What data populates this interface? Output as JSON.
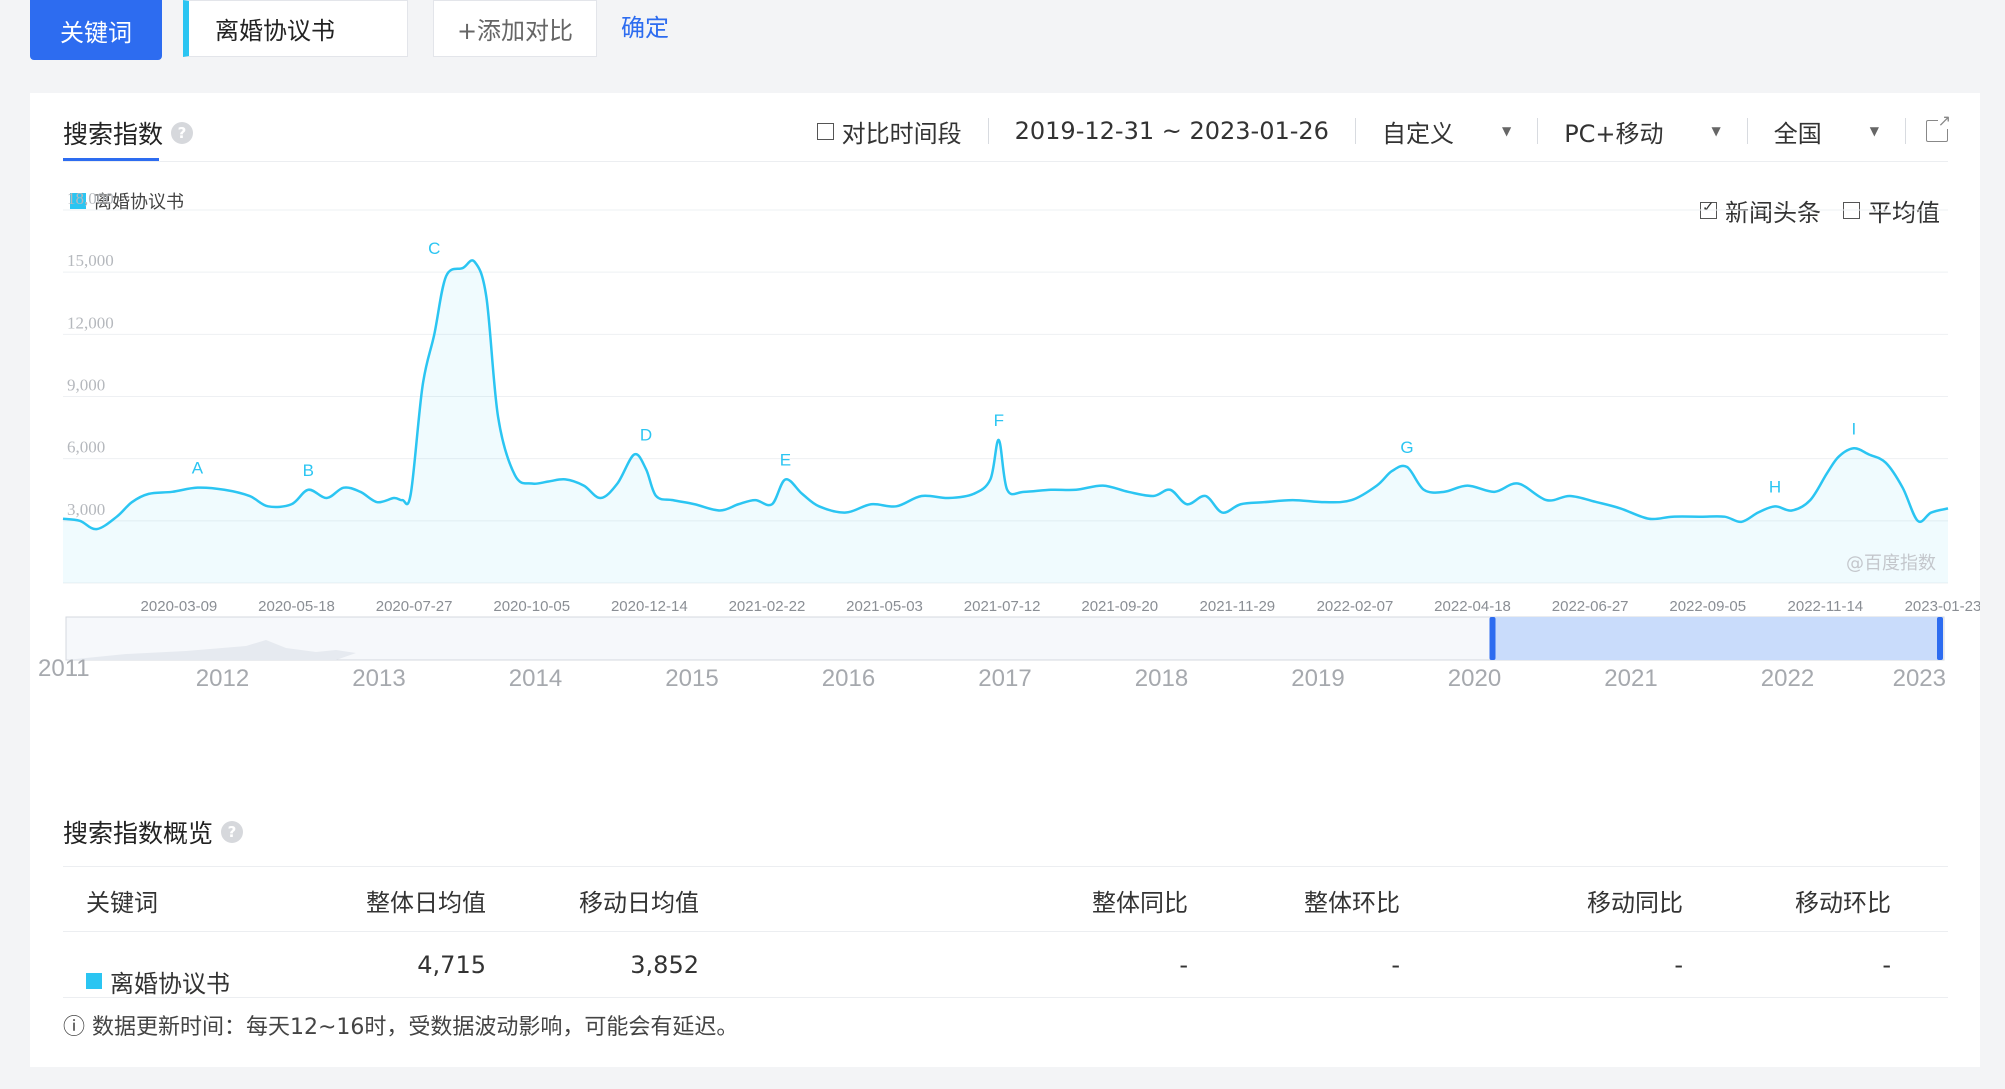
{
  "search": {
    "keyword_tab": "关键词",
    "keyword_value": "离婚协议书",
    "add_compare": "+添加对比",
    "confirm": "确定"
  },
  "header": {
    "title": "搜索指数",
    "compare_period": "对比时间段",
    "date_range": "2019-12-31 ~ 2023-01-26",
    "custom": "自定义",
    "device": "PC+移动",
    "region": "全国"
  },
  "options": {
    "news": "新闻头条",
    "average": "平均值"
  },
  "watermark": "@百度指数",
  "colors": {
    "accent": "#2d6cf0",
    "series": "#2bc5f2"
  },
  "chart_data": {
    "type": "area",
    "series": [
      {
        "name": "离婚协议书",
        "x": [
          "2019-12-31",
          "2020-01-10",
          "2020-01-20",
          "2020-02-01",
          "2020-02-10",
          "2020-02-20",
          "2020-03-05",
          "2020-03-20",
          "2020-04-05",
          "2020-04-20",
          "2020-05-01",
          "2020-05-15",
          "2020-05-25",
          "2020-06-05",
          "2020-06-15",
          "2020-06-25",
          "2020-07-05",
          "2020-07-15",
          "2020-07-20",
          "2020-07-25",
          "2020-08-01",
          "2020-08-08",
          "2020-08-15",
          "2020-08-25",
          "2020-09-01",
          "2020-09-08",
          "2020-09-15",
          "2020-09-25",
          "2020-10-05",
          "2020-10-15",
          "2020-10-25",
          "2020-11-05",
          "2020-11-15",
          "2020-11-25",
          "2020-12-05",
          "2020-12-12",
          "2020-12-18",
          "2020-12-28",
          "2021-01-10",
          "2021-01-25",
          "2021-02-05",
          "2021-02-15",
          "2021-02-25",
          "2021-03-05",
          "2021-03-15",
          "2021-03-25",
          "2021-04-10",
          "2021-04-25",
          "2021-05-10",
          "2021-05-25",
          "2021-06-10",
          "2021-06-25",
          "2021-07-05",
          "2021-07-10",
          "2021-07-15",
          "2021-07-25",
          "2021-08-10",
          "2021-08-25",
          "2021-09-10",
          "2021-09-25",
          "2021-10-10",
          "2021-10-20",
          "2021-10-30",
          "2021-11-10",
          "2021-11-20",
          "2021-12-01",
          "2021-12-15",
          "2022-01-01",
          "2022-01-20",
          "2022-02-05",
          "2022-02-20",
          "2022-03-01",
          "2022-03-10",
          "2022-03-20",
          "2022-04-01",
          "2022-04-15",
          "2022-05-01",
          "2022-05-15",
          "2022-06-01",
          "2022-06-15",
          "2022-07-01",
          "2022-07-15",
          "2022-08-01",
          "2022-08-15",
          "2022-09-01",
          "2022-09-15",
          "2022-09-25",
          "2022-10-05",
          "2022-10-15",
          "2022-10-25",
          "2022-11-05",
          "2022-11-15",
          "2022-11-22",
          "2022-12-01",
          "2022-12-10",
          "2022-12-20",
          "2022-12-30",
          "2023-01-08",
          "2023-01-16",
          "2023-01-26"
        ],
        "values": [
          3100,
          3000,
          2600,
          3200,
          3900,
          4300,
          4400,
          4600,
          4500,
          4200,
          3700,
          3800,
          4500,
          4100,
          4600,
          4400,
          3900,
          4100,
          4000,
          4300,
          9500,
          12000,
          14800,
          15200,
          15500,
          13800,
          8000,
          5200,
          4800,
          4900,
          5000,
          4700,
          4100,
          4800,
          6200,
          5500,
          4200,
          4000,
          3800,
          3500,
          3800,
          4000,
          3800,
          5000,
          4300,
          3700,
          3400,
          3800,
          3700,
          4200,
          4100,
          4300,
          5000,
          6900,
          4500,
          4400,
          4500,
          4500,
          4700,
          4400,
          4200,
          4500,
          3800,
          4200,
          3400,
          3800,
          3900,
          4000,
          3900,
          4000,
          4700,
          5400,
          5600,
          4500,
          4400,
          4700,
          4400,
          4800,
          4000,
          4200,
          3900,
          3600,
          3100,
          3200,
          3200,
          3200,
          2950,
          3400,
          3700,
          3500,
          4000,
          5300,
          6100,
          6500,
          6200,
          5800,
          4600,
          3000,
          3400,
          3600
        ]
      }
    ],
    "yticks": [
      "3,000",
      "6,000",
      "9,000",
      "12,000",
      "15,000",
      "18,000"
    ],
    "ylim": [
      0,
      18000
    ],
    "xticks": [
      "2020-03-09",
      "2020-05-18",
      "2020-07-27",
      "2020-10-05",
      "2020-12-14",
      "2021-02-22",
      "2021-05-03",
      "2021-07-12",
      "2021-09-20",
      "2021-11-29",
      "2022-02-07",
      "2022-04-18",
      "2022-06-27",
      "2022-09-05",
      "2022-11-14",
      "2023-01-23"
    ],
    "annotations": [
      {
        "label": "A",
        "x": "2020-03-20",
        "y": 4600
      },
      {
        "label": "B",
        "x": "2020-05-25",
        "y": 4500
      },
      {
        "label": "C",
        "x": "2020-08-08",
        "y": 15200
      },
      {
        "label": "D",
        "x": "2020-12-12",
        "y": 6200
      },
      {
        "label": "E",
        "x": "2021-03-05",
        "y": 5000
      },
      {
        "label": "F",
        "x": "2021-07-10",
        "y": 6900
      },
      {
        "label": "G",
        "x": "2022-03-10",
        "y": 5600
      },
      {
        "label": "H",
        "x": "2022-10-15",
        "y": 3700
      },
      {
        "label": "I",
        "x": "2022-12-01",
        "y": 6500
      }
    ],
    "grid": true,
    "legend": "top-left"
  },
  "navigator": {
    "years": [
      "2011",
      "2012",
      "2013",
      "2014",
      "2015",
      "2016",
      "2017",
      "2018",
      "2019",
      "2020",
      "2021",
      "2022",
      "2023"
    ],
    "selection": [
      "2020",
      "2023"
    ]
  },
  "overview": {
    "title": "搜索指数概览",
    "headers": [
      "关键词",
      "整体日均值",
      "移动日均值",
      "整体同比",
      "整体环比",
      "移动同比",
      "移动环比"
    ],
    "rows": [
      [
        "离婚协议书",
        "4,715",
        "3,852",
        "-",
        "-",
        "-",
        "-"
      ]
    ]
  },
  "note": "ⓘ 数据更新时间：每天12~16时，受数据波动影响，可能会有延迟。"
}
